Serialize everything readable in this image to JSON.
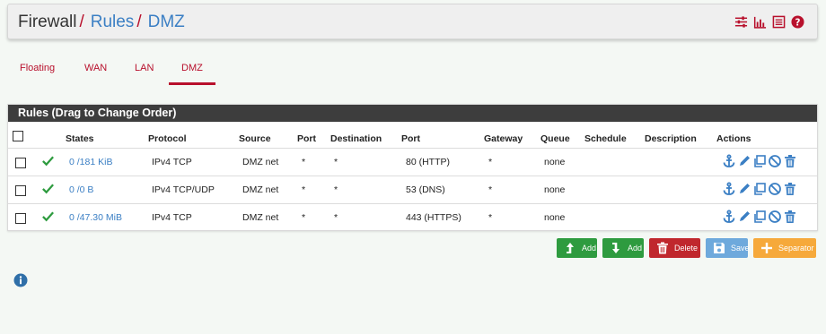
{
  "breadcrumb": {
    "root": "Firewall",
    "sep": "/",
    "rules": "Rules",
    "current": "DMZ"
  },
  "header_icons": [
    "sliders-icon",
    "bar-chart-icon",
    "list-icon",
    "help-icon"
  ],
  "tabs": [
    {
      "label": "Floating",
      "active": false
    },
    {
      "label": "WAN",
      "active": false
    },
    {
      "label": "LAN",
      "active": false
    },
    {
      "label": "DMZ",
      "active": true
    }
  ],
  "panel": {
    "title": "Rules (Drag to Change Order)"
  },
  "columns": {
    "states": "States",
    "protocol": "Protocol",
    "source": "Source",
    "port": "Port",
    "destination": "Destination",
    "dport": "Port",
    "gateway": "Gateway",
    "queue": "Queue",
    "schedule": "Schedule",
    "description": "Description",
    "actions": "Actions"
  },
  "rows": [
    {
      "states": "0 /181 KiB",
      "protocol": "IPv4 TCP",
      "source": "DMZ net",
      "port": "*",
      "destination": "*",
      "dport": "80 (HTTP)",
      "gateway": "*",
      "queue": "none",
      "schedule": "",
      "description": ""
    },
    {
      "states": "0 /0 B",
      "protocol": "IPv4 TCP/UDP",
      "source": "DMZ net",
      "port": "*",
      "destination": "*",
      "dport": "53 (DNS)",
      "gateway": "*",
      "queue": "none",
      "schedule": "",
      "description": ""
    },
    {
      "states": "0 /47.30 MiB",
      "protocol": "IPv4 TCP",
      "source": "DMZ net",
      "port": "*",
      "destination": "*",
      "dport": "443 (HTTPS)",
      "gateway": "*",
      "queue": "none",
      "schedule": "",
      "description": ""
    }
  ],
  "buttons": {
    "add_top": "Add",
    "add_bottom": "Add",
    "delete": "Delete",
    "save": "Save",
    "separator": "Separator"
  },
  "colors": {
    "accent": "#b8102c",
    "link": "#3b7fc4",
    "green": "#2e9b3f",
    "red": "#c0272d",
    "blue": "#6ea9dc",
    "orange": "#f6a93b"
  }
}
